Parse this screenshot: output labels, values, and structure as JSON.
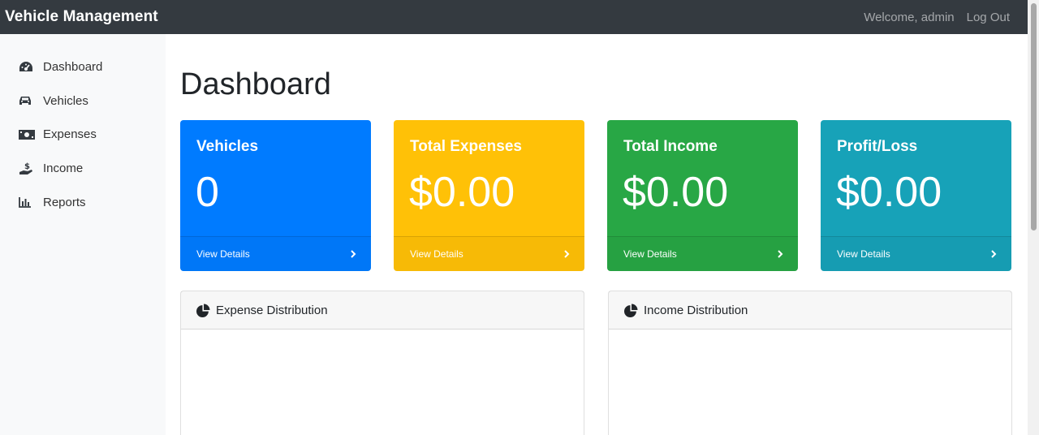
{
  "navbar": {
    "brand": "Vehicle Management",
    "welcome": "Welcome, admin",
    "logout": "Log Out"
  },
  "sidebar": {
    "items": [
      {
        "label": "Dashboard",
        "icon": "tachometer-icon"
      },
      {
        "label": "Vehicles",
        "icon": "car-icon"
      },
      {
        "label": "Expenses",
        "icon": "money-bill-icon"
      },
      {
        "label": "Income",
        "icon": "hand-holding-usd-icon"
      },
      {
        "label": "Reports",
        "icon": "bar-chart-icon"
      }
    ]
  },
  "main": {
    "title": "Dashboard",
    "cards": [
      {
        "title": "Vehicles",
        "value": "0",
        "footer": "View Details",
        "color": "#007bff"
      },
      {
        "title": "Total Expenses",
        "value": "$0.00",
        "footer": "View Details",
        "color": "#ffc107"
      },
      {
        "title": "Total Income",
        "value": "$0.00",
        "footer": "View Details",
        "color": "#28a745"
      },
      {
        "title": "Profit/Loss",
        "value": "$0.00",
        "footer": "View Details",
        "color": "#17a2b8"
      }
    ],
    "panels": [
      {
        "title": "Expense Distribution",
        "icon": "pie-chart-icon"
      },
      {
        "title": "Income Distribution",
        "icon": "pie-chart-icon"
      }
    ]
  },
  "colors": {
    "navbar": "#343a40",
    "sidebar": "#f8f9fa"
  }
}
